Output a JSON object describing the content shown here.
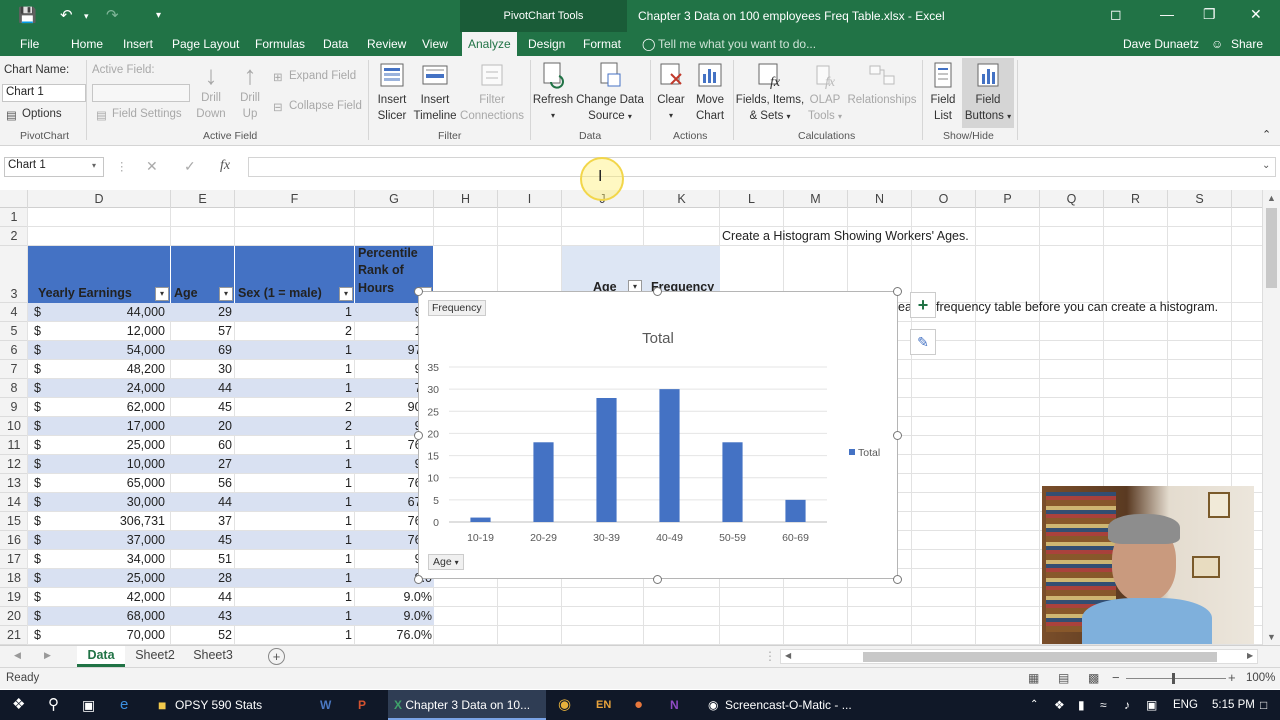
{
  "titlebar": {
    "context_tab": "PivotChart Tools",
    "document_title": "Chapter 3 Data on 100 employees Freq Table.xlsx - Excel"
  },
  "tabs": [
    {
      "label": "File"
    },
    {
      "label": "Home"
    },
    {
      "label": "Insert"
    },
    {
      "label": "Page Layout"
    },
    {
      "label": "Formulas"
    },
    {
      "label": "Data"
    },
    {
      "label": "Review"
    },
    {
      "label": "View"
    },
    {
      "label": "Analyze"
    },
    {
      "label": "Design"
    },
    {
      "label": "Format"
    }
  ],
  "tell_me": "Tell me what you want to do...",
  "user": "Dave Dunaetz",
  "share": "Share",
  "ribbon": {
    "chart_name_label": "Chart Name:",
    "chart_name_value": "Chart 1",
    "options": "Options",
    "pivotchart_group": "PivotChart",
    "active_field_label": "Active Field:",
    "field_settings": "Field Settings",
    "drill_down": [
      "Drill",
      "Down"
    ],
    "drill_up": [
      "Drill",
      "Up"
    ],
    "expand_field": "Expand Field",
    "collapse_field": "Collapse Field",
    "active_field_group": "Active Field",
    "insert_slicer": [
      "Insert",
      "Slicer"
    ],
    "insert_timeline": [
      "Insert",
      "Timeline"
    ],
    "filter_connections": [
      "Filter",
      "Connections"
    ],
    "filter_group": "Filter",
    "refresh": "Refresh",
    "change_data_source": [
      "Change Data",
      "Source"
    ],
    "data_group": "Data",
    "clear": "Clear",
    "move_chart": [
      "Move",
      "Chart"
    ],
    "actions_group": "Actions",
    "fields_items_sets": [
      "Fields, Items,",
      "& Sets"
    ],
    "olap_tools": [
      "OLAP",
      "Tools"
    ],
    "relationships": "Relationships",
    "calculations_group": "Calculations",
    "field_list": [
      "Field",
      "List"
    ],
    "field_buttons": [
      "Field",
      "Buttons"
    ],
    "showhide_group": "Show/Hide"
  },
  "formula_bar": {
    "name_box": "Chart 1",
    "fx": "fx",
    "content": ""
  },
  "columns": [
    "D",
    "E",
    "F",
    "G",
    "H",
    "I",
    "J",
    "K",
    "L",
    "M",
    "N",
    "O",
    "P",
    "Q",
    "R",
    "S"
  ],
  "rows": [
    "1",
    "2",
    "3",
    "4",
    "5",
    "6",
    "7",
    "8",
    "9",
    "10",
    "11",
    "12",
    "13",
    "14",
    "15",
    "16",
    "17",
    "18",
    "19",
    "20",
    "21"
  ],
  "table_headers": {
    "yearly_earnings": "Yearly Earnings",
    "age": "Age",
    "sex": "Sex (1 = male)",
    "percentile_1": "Percentile",
    "percentile_2": "Rank of",
    "percentile_3": "Hours"
  },
  "table_rows": [
    {
      "cur": "$",
      "earn": "44,000",
      "age": "29",
      "sex": "1",
      "pct": "9.0"
    },
    {
      "cur": "$",
      "earn": "12,000",
      "age": "57",
      "sex": "2",
      "pct": "1.0"
    },
    {
      "cur": "$",
      "earn": "54,000",
      "age": "69",
      "sex": "1",
      "pct": "97.0"
    },
    {
      "cur": "$",
      "earn": "48,200",
      "age": "30",
      "sex": "1",
      "pct": "9.0"
    },
    {
      "cur": "$",
      "earn": "24,000",
      "age": "44",
      "sex": "1",
      "pct": "7.0"
    },
    {
      "cur": "$",
      "earn": "62,000",
      "age": "45",
      "sex": "2",
      "pct": "90.0"
    },
    {
      "cur": "$",
      "earn": "17,000",
      "age": "20",
      "sex": "2",
      "pct": "9.0"
    },
    {
      "cur": "$",
      "earn": "25,000",
      "age": "60",
      "sex": "1",
      "pct": "76.0"
    },
    {
      "cur": "$",
      "earn": "10,000",
      "age": "27",
      "sex": "1",
      "pct": "9.0"
    },
    {
      "cur": "$",
      "earn": "65,000",
      "age": "56",
      "sex": "1",
      "pct": "76.0"
    },
    {
      "cur": "$",
      "earn": "30,000",
      "age": "44",
      "sex": "1",
      "pct": "67.0"
    },
    {
      "cur": "$",
      "earn": "306,731",
      "age": "37",
      "sex": "1",
      "pct": "76.0"
    },
    {
      "cur": "$",
      "earn": "37,000",
      "age": "45",
      "sex": "1",
      "pct": "76.0"
    },
    {
      "cur": "$",
      "earn": "34,000",
      "age": "51",
      "sex": "1",
      "pct": "9.0"
    },
    {
      "cur": "$",
      "earn": "25,000",
      "age": "28",
      "sex": "1",
      "pct": "9.0"
    },
    {
      "cur": "$",
      "earn": "42,000",
      "age": "44",
      "sex": "1",
      "pct": "9.0%"
    },
    {
      "cur": "$",
      "earn": "68,000",
      "age": "43",
      "sex": "1",
      "pct": "9.0%"
    },
    {
      "cur": "$",
      "earn": "70,000",
      "age": "52",
      "sex": "1",
      "pct": "76.0%"
    }
  ],
  "pivot": {
    "age_header": "Age",
    "freq_header": "Frequency"
  },
  "notes": {
    "histogram_title": "Create a Histogram Showing Workers' Ages.",
    "freq_note_prefix": "ea",
    "freq_note": "frequency table before you can create a histogram."
  },
  "chart_data": {
    "type": "bar",
    "title": "Total",
    "field_button_top": "Frequency",
    "field_button_axis": "Age",
    "categories": [
      "10-19",
      "20-29",
      "30-39",
      "40-49",
      "50-59",
      "60-69"
    ],
    "series": [
      {
        "name": "Total",
        "values": [
          1,
          18,
          28,
          30,
          18,
          5
        ]
      }
    ],
    "ylim": [
      0,
      35
    ],
    "yticks": [
      "0",
      "5",
      "10",
      "15",
      "20",
      "25",
      "30",
      "35"
    ],
    "grid": true,
    "legend": "right",
    "bar_color": "#4472c4"
  },
  "sheets": [
    {
      "label": "Data"
    },
    {
      "label": "Sheet2"
    },
    {
      "label": "Sheet3"
    }
  ],
  "status": {
    "ready": "Ready",
    "zoom": "100%"
  },
  "taskbar": {
    "items": [
      "OPSY 590 Stats",
      "Chapter 3 Data on 10...",
      "Screencast-O-Matic - ..."
    ],
    "lang": "ENG",
    "time": "5:15 PM"
  }
}
